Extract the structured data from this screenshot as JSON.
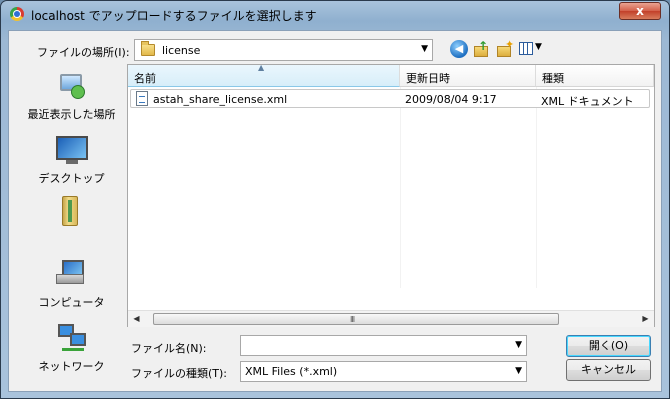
{
  "window": {
    "title": "localhost でアップロードするファイルを選択します",
    "close_glyph": "x"
  },
  "toolbar": {
    "look_in_label": "ファイルの場所(I):",
    "look_in_value": "license",
    "dropdown_glyph": "▼",
    "icons": [
      "back-icon",
      "up-folder-icon",
      "new-folder-icon",
      "views-menu-icon"
    ]
  },
  "places": [
    {
      "label": "最近表示した場所",
      "icon": "recent-places-icon"
    },
    {
      "label": "デスクトップ",
      "icon": "desktop-icon"
    },
    {
      "label": "",
      "icon": "documents-icon"
    },
    {
      "label": "コンピュータ",
      "icon": "computer-icon"
    },
    {
      "label": "ネットワーク",
      "icon": "network-icon"
    }
  ],
  "filelist": {
    "columns": [
      "名前",
      "更新日時",
      "種類"
    ],
    "sort_glyph": "▲",
    "rows": [
      {
        "name": "astah_share_license.xml",
        "modified": "2009/08/04 9:17",
        "type": "XML ドキュメント"
      }
    ],
    "scroll_left": "◀",
    "scroll_right": "▶",
    "scroll_grip": "III"
  },
  "footer": {
    "filename_label": "ファイル名(N):",
    "filename_value": "",
    "filetype_label": "ファイルの種類(T):",
    "filetype_value": "XML Files (*.xml)",
    "open_label": "開く(O)",
    "cancel_label": "キャンセル"
  },
  "colors": {
    "frame": "#a9c3dc",
    "close_button": "#c2402a",
    "client_bg": "#f0f0f0",
    "header_sorted": "#d7eef9"
  }
}
